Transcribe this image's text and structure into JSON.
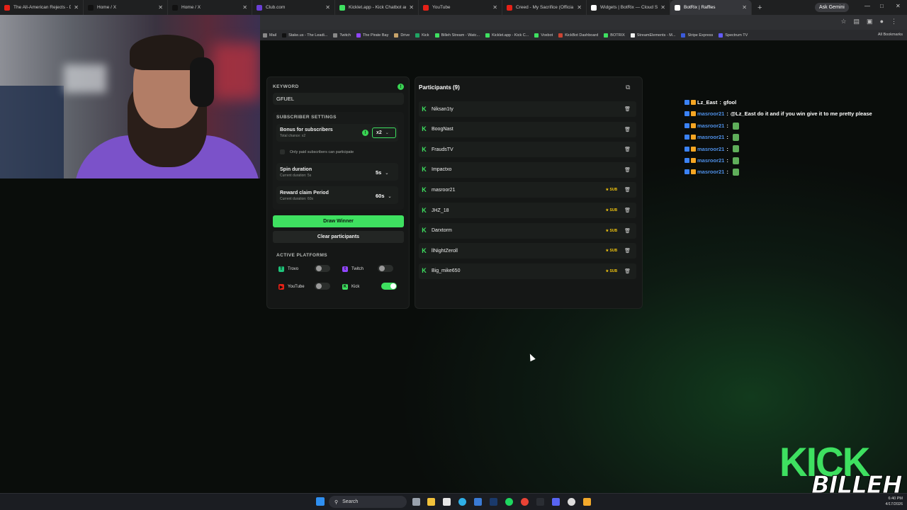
{
  "browser": {
    "tabs": [
      {
        "title": "The All-American Rejects - Dirt",
        "color": "#e62117"
      },
      {
        "title": "Home / X",
        "color": "#111111"
      },
      {
        "title": "Home / X",
        "color": "#111111"
      },
      {
        "title": "Club.com",
        "color": "#6a3fd6"
      },
      {
        "title": "Kicklet.app - Kick Chatbot and",
        "color": "#3ee060"
      },
      {
        "title": "YouTube",
        "color": "#e62117"
      },
      {
        "title": "Creed - My Sacrifice (Officia",
        "color": "#e62117"
      },
      {
        "title": "Widgets | BotRix — Cloud Stre",
        "color": "#ffffff"
      },
      {
        "title": "BotRix | Raffles",
        "color": "#ffffff"
      }
    ],
    "ask_gemini": "Ask Gemini",
    "bookmarks": [
      "Mail",
      "Stake.us - The Leadi...",
      "Twitch",
      "The Pirate Bay",
      "Drive",
      "Kick",
      "Billeh Stream - Watc...",
      "Kicklet.app - Kick C...",
      "Voxbot",
      "KickBot Dashboard",
      "BOTRIX",
      "StreamElements - M...",
      "Stripe Express",
      "Spectrum TV"
    ],
    "all_bookmarks": "All Bookmarks"
  },
  "settings": {
    "keyword_label": "KEYWORD",
    "keyword_value": "GFUEL",
    "subscriber_settings_label": "SUBSCRIBER SETTINGS",
    "bonus_title": "Bonus for subscribers",
    "bonus_sub": "Total chance: x2",
    "bonus_value": "x2",
    "only_paid_label": "Only paid subscribers can participate",
    "spin_title": "Spin duration",
    "spin_sub": "Current duration: 5s",
    "spin_value": "5s",
    "claim_title": "Reward claim Period",
    "claim_sub": "Current duration: 60s",
    "claim_value": "60s",
    "draw_button": "Draw Winner",
    "clear_button": "Clear participants",
    "platforms_label": "ACTIVE PLATFORMS",
    "platforms": [
      {
        "name": "Trovo",
        "enabled": false,
        "color": "#1fc47a"
      },
      {
        "name": "Twitch",
        "enabled": false,
        "color": "#9146ff"
      },
      {
        "name": "YouTube",
        "enabled": false,
        "color": "#e62117"
      },
      {
        "name": "Kick",
        "enabled": true,
        "color": "#3ee060"
      }
    ]
  },
  "participants": {
    "title": "Participants (9)",
    "sub_badge": "SUB",
    "list": [
      {
        "name": "Niksan1ty",
        "sub": false
      },
      {
        "name": "BoogNast",
        "sub": false
      },
      {
        "name": "FraudsTV",
        "sub": false
      },
      {
        "name": "Impactxo",
        "sub": false
      },
      {
        "name": "masroor21",
        "sub": true
      },
      {
        "name": "JHZ_18",
        "sub": true
      },
      {
        "name": "Darxtorm",
        "sub": true
      },
      {
        "name": "llNightZeroll",
        "sub": true
      },
      {
        "name": "Big_mike650",
        "sub": true
      }
    ]
  },
  "chat": [
    {
      "user": "Lz_East",
      "sep": ":",
      "msg": "gfool",
      "user_color": "#ffffff"
    },
    {
      "user": "masroor21",
      "sep": ":",
      "msg": "@Lz_East do it and if you win give it to me pretty please",
      "user_color": "#4e8fe6"
    },
    {
      "user": "masroor21",
      "sep": ":",
      "msg": "",
      "user_color": "#4e8fe6"
    },
    {
      "user": "masroor21",
      "sep": ":",
      "msg": "",
      "user_color": "#4e8fe6"
    },
    {
      "user": "masroor21",
      "sep": ":",
      "msg": "",
      "user_color": "#4e8fe6"
    },
    {
      "user": "masroor21",
      "sep": ":",
      "msg": "",
      "user_color": "#4e8fe6"
    },
    {
      "user": "masroor21",
      "sep": ":",
      "msg": "",
      "user_color": "#4e8fe6"
    }
  ],
  "taskbar": {
    "search_placeholder": "Search",
    "time": "6:40 PM",
    "date": "4/17/2026"
  },
  "overlay": {
    "kick_logo": "KICK",
    "billeh_logo": "BILLEH"
  }
}
